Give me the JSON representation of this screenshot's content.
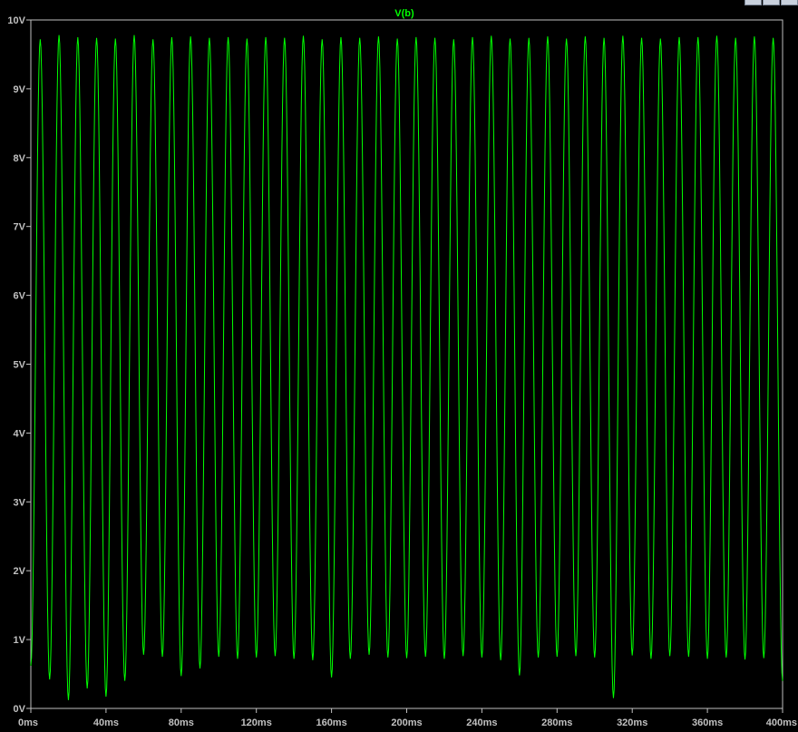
{
  "chart_data": {
    "type": "line",
    "title": "V(b)",
    "xlabel": "",
    "ylabel": "",
    "xlim": [
      0,
      400
    ],
    "ylim": [
      0,
      10
    ],
    "x_ticks": [
      "0ms",
      "40ms",
      "80ms",
      "120ms",
      "160ms",
      "200ms",
      "240ms",
      "280ms",
      "320ms",
      "360ms",
      "400ms"
    ],
    "y_ticks": [
      "0V",
      "1V",
      "2V",
      "3V",
      "4V",
      "5V",
      "6V",
      "7V",
      "8V",
      "9V",
      "10V"
    ],
    "grid": false,
    "series": [
      {
        "name": "V(b)",
        "color": "#00ff00",
        "period_ms": 10,
        "peaks": [
          9.72,
          9.78,
          9.75,
          9.74,
          9.73,
          9.78,
          9.72,
          9.75,
          9.76,
          9.74,
          9.75,
          9.73,
          9.75,
          9.74,
          9.77,
          9.72,
          9.75,
          9.74,
          9.76,
          9.73,
          9.75,
          9.74,
          9.72,
          9.75,
          9.77,
          9.73,
          9.74,
          9.76,
          9.73,
          9.76,
          9.74,
          9.77,
          9.74,
          9.73,
          9.75,
          9.75,
          9.77,
          9.74,
          9.76,
          9.74
        ],
        "troughs": [
          0.62,
          0.42,
          0.12,
          0.29,
          0.17,
          0.4,
          0.78,
          0.75,
          0.47,
          0.58,
          0.75,
          0.72,
          0.74,
          0.76,
          0.72,
          0.7,
          0.45,
          0.72,
          0.78,
          0.74,
          0.73,
          0.75,
          0.72,
          0.76,
          0.74,
          0.7,
          0.48,
          0.74,
          0.75,
          0.76,
          0.74,
          0.15,
          0.77,
          0.72,
          0.76,
          0.75,
          0.72,
          0.74,
          0.71,
          0.73,
          0.4
        ]
      }
    ]
  },
  "colors": {
    "background": "#000000",
    "axis": "#c0c0c0",
    "trace": "#00ff00"
  }
}
